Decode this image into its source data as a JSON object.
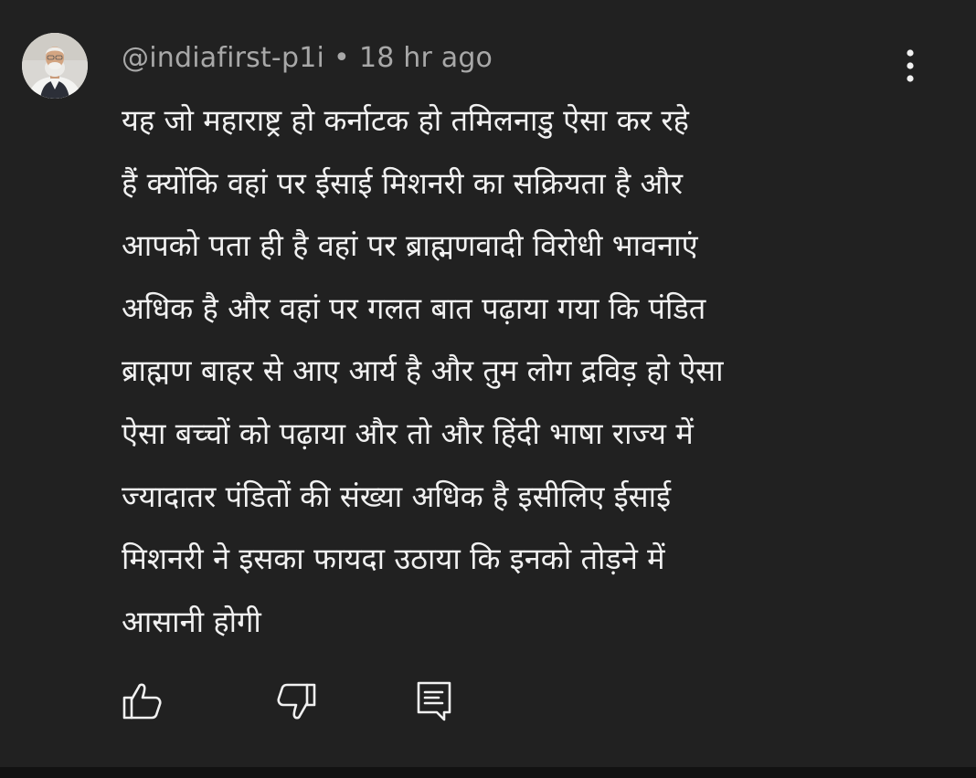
{
  "comment": {
    "author": "@indiafirst-p1i",
    "separator": "•",
    "timestamp": "18 hr ago",
    "lines": [
      "यह जो महाराष्ट्र हो कर्नाटक हो तमिलनाडु ऐसा कर रहे",
      "हैं क्योंकि वहां पर ईसाई मिशनरी का सक्रियता है और",
      "आपको पता ही है वहां पर ब्राह्मणवादी विरोधी भावनाएं",
      "अधिक है और वहां पर गलत बात पढ़ाया गया कि पंडित",
      "ब्राह्मण बाहर से आए आर्य है और तुम लोग द्रविड़ हो ऐसा",
      "ऐसा बच्चों को पढ़ाया और तो और हिंदी भाषा राज्य में",
      "ज्यादातर पंडितों की संख्या अधिक है इसीलिए ईसाई",
      "मिशनरी ने इसका फायदा उठाया कि इनको तोड़ने में",
      "आसानी होगी"
    ]
  },
  "icons": {
    "avatar": "avatar",
    "menu": "more-vertical-icon",
    "like": "thumbs-up-icon",
    "dislike": "thumbs-down-icon",
    "reply": "reply-comment-icon"
  },
  "colors": {
    "background": "#212121",
    "text_primary": "#f1f1f1",
    "text_secondary": "#a8a8a8"
  }
}
